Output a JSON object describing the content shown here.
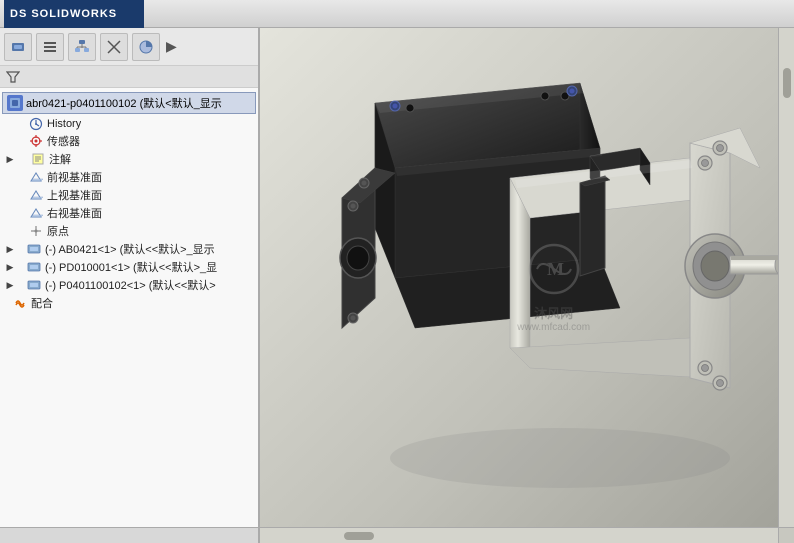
{
  "app": {
    "title": "SOLIDWORKS",
    "logo_text": "DS SOLIDWORKS"
  },
  "toolbar": {
    "buttons": [
      {
        "id": "tb1",
        "icon": "assembly-icon",
        "label": "Assembly"
      },
      {
        "id": "tb2",
        "icon": "list-icon",
        "label": "List"
      },
      {
        "id": "tb3",
        "icon": "tree-icon",
        "label": "Tree"
      },
      {
        "id": "tb4",
        "icon": "cross-icon",
        "label": "Cross"
      },
      {
        "id": "tb5",
        "icon": "pie-icon",
        "label": "Pie"
      }
    ],
    "more_arrow": "▶"
  },
  "tree": {
    "root_label": "abr0421-p0401100102 (默认<默认_显示",
    "items": [
      {
        "id": "history",
        "label": "History",
        "icon": "history-icon",
        "indent": 1,
        "expandable": false
      },
      {
        "id": "sensor",
        "label": "传感器",
        "icon": "sensor-icon",
        "indent": 1,
        "expandable": false
      },
      {
        "id": "annotation",
        "label": "注解",
        "icon": "annotation-icon",
        "indent": 1,
        "expandable": true,
        "expanded": false
      },
      {
        "id": "front-plane",
        "label": "前视基准面",
        "icon": "plane-icon",
        "indent": 1,
        "expandable": false
      },
      {
        "id": "top-plane",
        "label": "上视基准面",
        "icon": "plane-icon",
        "indent": 1,
        "expandable": false
      },
      {
        "id": "right-plane",
        "label": "右视基准面",
        "icon": "plane-icon",
        "indent": 1,
        "expandable": false
      },
      {
        "id": "origin",
        "label": "原点",
        "icon": "origin-icon",
        "indent": 1,
        "expandable": false
      },
      {
        "id": "ab0421",
        "label": "(-) AB0421<1> (默认<<默认>_显示",
        "icon": "component-icon",
        "indent": 0,
        "expandable": true,
        "expanded": false
      },
      {
        "id": "pd010001",
        "label": "(-) PD010001<1> (默认<<默认>_显",
        "icon": "component-icon",
        "indent": 0,
        "expandable": true,
        "expanded": false
      },
      {
        "id": "p0401100102",
        "label": "(-) P0401100102<1> (默认<<默认>",
        "icon": "component-icon",
        "indent": 0,
        "expandable": true,
        "expanded": false
      },
      {
        "id": "mate",
        "label": "配合",
        "icon": "mate-icon",
        "indent": 0,
        "expandable": false
      }
    ]
  },
  "viewport": {
    "background_color": "#c8c8c4"
  },
  "watermark": {
    "site": "沐风网",
    "url": "www.mfcad.com",
    "icon": "M"
  }
}
